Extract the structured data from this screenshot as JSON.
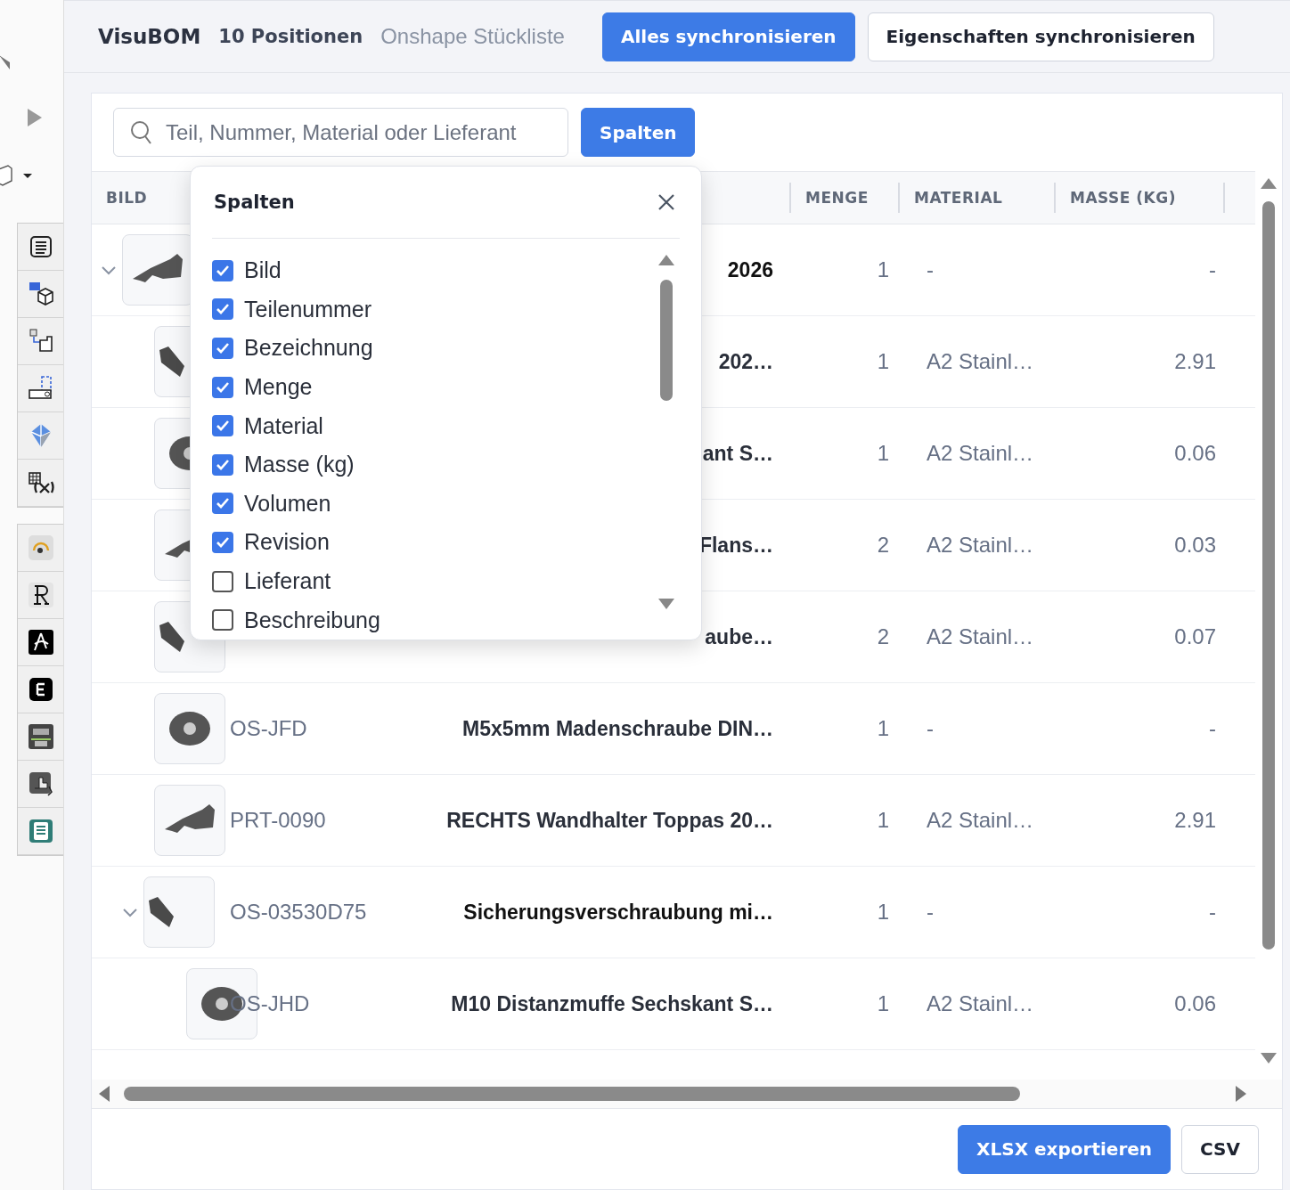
{
  "header": {
    "app_name": "VisuBOM",
    "count": "10 Positionen",
    "subtitle": "Onshape Stückliste",
    "buttons": [
      {
        "label": "Alles synchronisieren",
        "kind": "primary"
      },
      {
        "label": "Eigenschaften synchronisieren",
        "kind": "secondary"
      }
    ]
  },
  "search": {
    "placeholder": "Teil, Nummer, Material oder Lieferant"
  },
  "columns_button": "Spalten",
  "table": {
    "columns": [
      "BILD",
      "MENGE",
      "MATERIAL",
      "MASSE (KG)"
    ],
    "rows": [
      {
        "description": "2026",
        "quantity": "1",
        "material": "-",
        "mass": "-",
        "expanded": true,
        "children": [
          {
            "description": "202…",
            "quantity": "1",
            "material": "A2 Stainl…",
            "mass": "2.91"
          },
          {
            "description": "ant S…",
            "quantity": "1",
            "material": "A2 Stainl…",
            "mass": "0.06"
          },
          {
            "description": "Flans…",
            "quantity": "2",
            "material": "A2 Stainl…",
            "mass": "0.03"
          },
          {
            "description": "aube…",
            "quantity": "2",
            "material": "A2 Stainl…",
            "mass": "0.07"
          },
          {
            "part": "OS-JFD",
            "description": "M5x5mm Madenschraube DIN…",
            "quantity": "1",
            "material": "-",
            "mass": "-"
          },
          {
            "part": "PRT-0090",
            "description": "RECHTS Wandhalter Toppas 20…",
            "quantity": "1",
            "material": "A2 Stainl…",
            "mass": "2.91"
          },
          {
            "part": "OS-03530D75",
            "description": "Sicherungsverschraubung mi…",
            "quantity": "1",
            "material": "-",
            "mass": "-",
            "expanded": true,
            "children": [
              {
                "part": "OS-JHD",
                "description": "M10 Distanzmuffe Sechskant S…",
                "quantity": "1",
                "material": "A2 Stainl…",
                "mass": "0.06"
              }
            ]
          }
        ]
      }
    ]
  },
  "columns_popup": {
    "title": "Spalten",
    "items": [
      {
        "label": "Bild",
        "checked": true
      },
      {
        "label": "Teilenummer",
        "checked": true
      },
      {
        "label": "Bezeichnung",
        "checked": true
      },
      {
        "label": "Menge",
        "checked": true
      },
      {
        "label": "Material",
        "checked": true
      },
      {
        "label": "Masse (kg)",
        "checked": true
      },
      {
        "label": "Volumen",
        "checked": true
      },
      {
        "label": "Revision",
        "checked": true
      },
      {
        "label": "Lieferant",
        "checked": false
      },
      {
        "label": "Beschreibung",
        "checked": false
      }
    ]
  },
  "footer": {
    "buttons": [
      {
        "label": "XLSX exportieren",
        "kind": "primary"
      },
      {
        "label": "CSV",
        "kind": "secondary"
      }
    ]
  }
}
